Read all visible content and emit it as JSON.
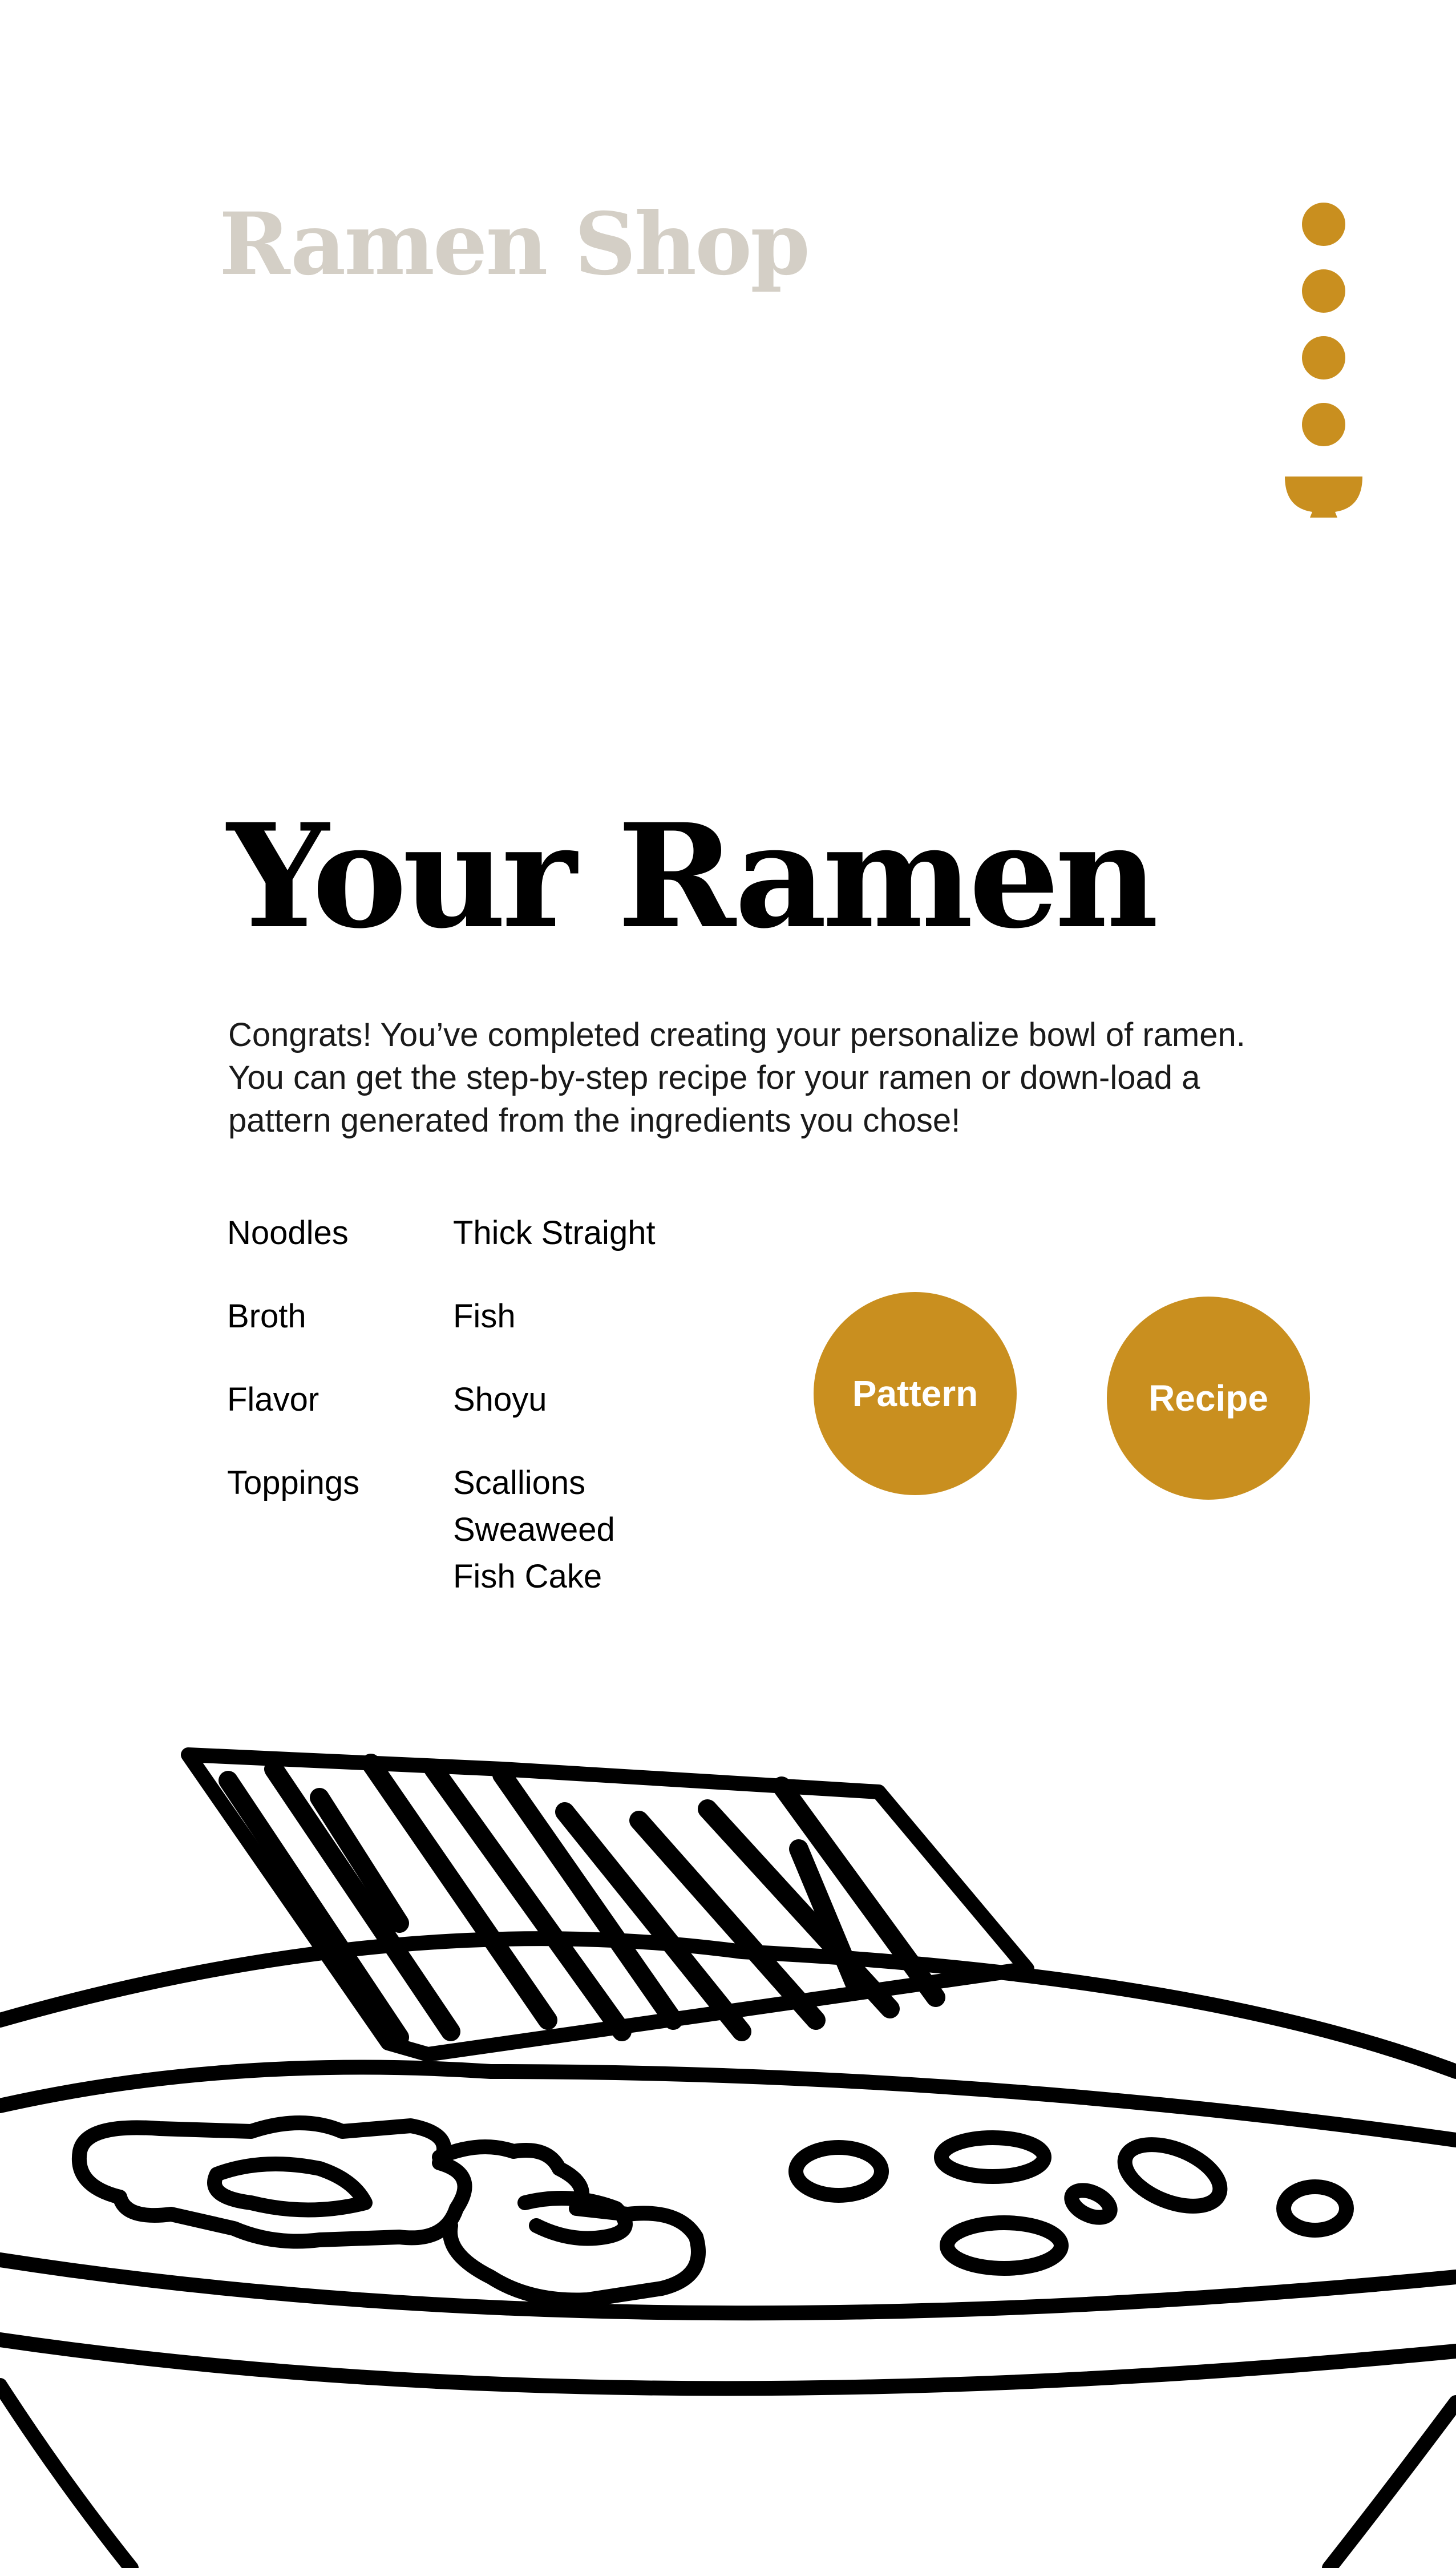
{
  "header": {
    "logo_text": "Ramen Shop",
    "progress_icons": [
      "dot-icon",
      "dot-icon",
      "dot-icon",
      "dot-icon",
      "bowl-icon"
    ]
  },
  "main": {
    "title": "Your Ramen",
    "intro": "Congrats! You’ve completed creating your personalize bowl of ramen. You can get the step-by-step recipe for your ramen or down-load a pattern generated from the ingredients you chose!",
    "summary": [
      {
        "label": "Noodles",
        "values": [
          "Thick Straight"
        ]
      },
      {
        "label": "Broth",
        "values": [
          "Fish"
        ]
      },
      {
        "label": "Flavor",
        "values": [
          "Shoyu"
        ]
      },
      {
        "label": "Toppings",
        "values": [
          "Scallions",
          "Sweaweed",
          "Fish Cake"
        ]
      }
    ],
    "pattern_button": "Pattern",
    "recipe_button": "Recipe"
  },
  "illustration": {
    "name": "ramen-bowl-illustration"
  },
  "colors": {
    "accent": "#c98f1f",
    "logo": "#d4cfc6",
    "text": "#000000",
    "background": "#ffffff"
  }
}
